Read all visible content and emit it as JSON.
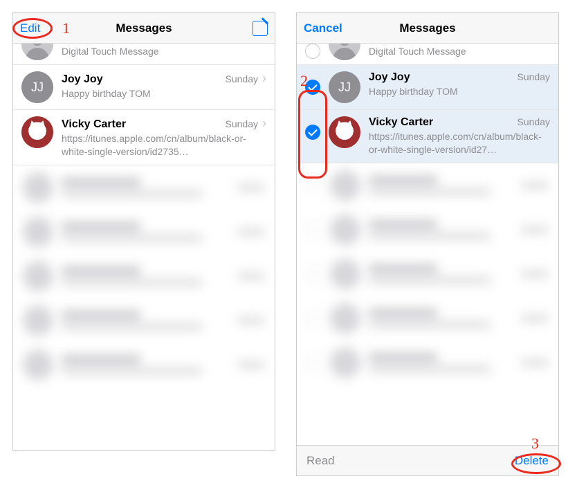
{
  "annotations": {
    "step1": "1",
    "step2": "2",
    "step3": "3"
  },
  "left": {
    "nav": {
      "edit": "Edit",
      "title": "Messages"
    },
    "rows": [
      {
        "name": "",
        "preview": "Digital Touch Message",
        "date": ""
      },
      {
        "name": "Joy Joy",
        "initials": "JJ",
        "preview": "Happy birthday TOM",
        "date": "Sunday"
      },
      {
        "name": "Vicky Carter",
        "preview": "https://itunes.apple.com/cn/album/black-or-white-single-version/id2735…",
        "date": "Sunday"
      }
    ]
  },
  "right": {
    "nav": {
      "cancel": "Cancel",
      "title": "Messages"
    },
    "rows": [
      {
        "name": "",
        "preview": "Digital Touch Message",
        "date": "",
        "checked": false
      },
      {
        "name": "Joy Joy",
        "initials": "JJ",
        "preview": "Happy birthday TOM",
        "date": "Sunday",
        "checked": true
      },
      {
        "name": "Vicky Carter",
        "preview": "https://itunes.apple.com/cn/album/black-or-white-single-version/id27…",
        "date": "Sunday",
        "checked": true
      }
    ],
    "toolbar": {
      "read": "Read",
      "delete": "Delete"
    }
  }
}
